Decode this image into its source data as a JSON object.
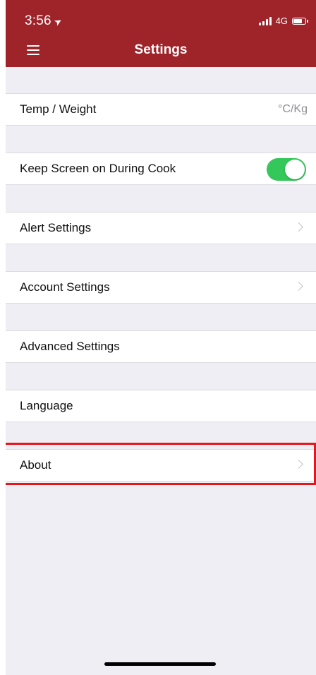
{
  "status_bar": {
    "time": "3:56",
    "network": "4G"
  },
  "header": {
    "title": "Settings"
  },
  "settings": {
    "temp_weight": {
      "label": "Temp / Weight",
      "value": "°C/Kg"
    },
    "keep_screen_on": {
      "label": "Keep Screen on During Cook",
      "enabled": true
    },
    "alert_settings": {
      "label": "Alert Settings"
    },
    "account_settings": {
      "label": "Account Settings"
    },
    "advanced_settings": {
      "label": "Advanced Settings"
    },
    "language": {
      "label": "Language"
    },
    "about": {
      "label": "About"
    }
  },
  "colors": {
    "header_bg": "#9e242a",
    "toggle_on": "#34c759",
    "highlight": "#e6171c",
    "background": "#efeef4"
  }
}
